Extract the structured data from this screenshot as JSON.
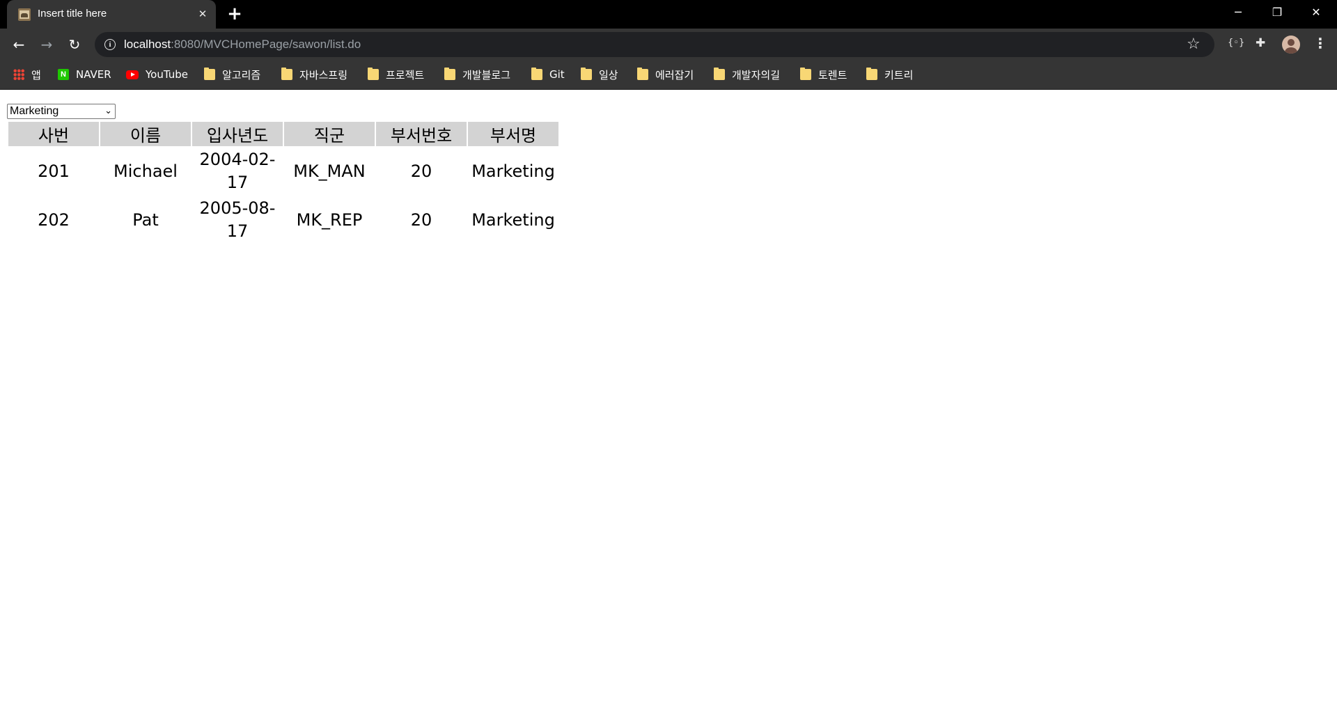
{
  "browser": {
    "tab_title": "Insert title here",
    "url_host": "localhost",
    "url_path": ":8080/MVCHomePage/sawon/list.do",
    "bookmarks": [
      {
        "label": "앱",
        "icon": "apps-icon"
      },
      {
        "label": "NAVER",
        "icon": "naver-icon"
      },
      {
        "label": "YouTube",
        "icon": "youtube-icon"
      },
      {
        "label": "알고리즘",
        "icon": "folder-icon"
      },
      {
        "label": "자바스프링",
        "icon": "folder-icon"
      },
      {
        "label": "프로젝트",
        "icon": "folder-icon"
      },
      {
        "label": "개발블로그",
        "icon": "folder-icon"
      },
      {
        "label": "Git",
        "icon": "folder-icon"
      },
      {
        "label": "일상",
        "icon": "folder-icon"
      },
      {
        "label": "에러잡기",
        "icon": "folder-icon"
      },
      {
        "label": "개발자의길",
        "icon": "folder-icon"
      },
      {
        "label": "토렌트",
        "icon": "folder-icon"
      },
      {
        "label": "키트리",
        "icon": "folder-icon"
      }
    ]
  },
  "page": {
    "department_select": {
      "selected": "Marketing"
    },
    "table": {
      "headers": [
        "사번",
        "이름",
        "입사년도",
        "직군",
        "부서번호",
        "부서명"
      ],
      "rows": [
        [
          "201",
          "Michael",
          "2004-02-17",
          "MK_MAN",
          "20",
          "Marketing"
        ],
        [
          "202",
          "Pat",
          "2005-08-17",
          "MK_REP",
          "20",
          "Marketing"
        ]
      ]
    }
  }
}
